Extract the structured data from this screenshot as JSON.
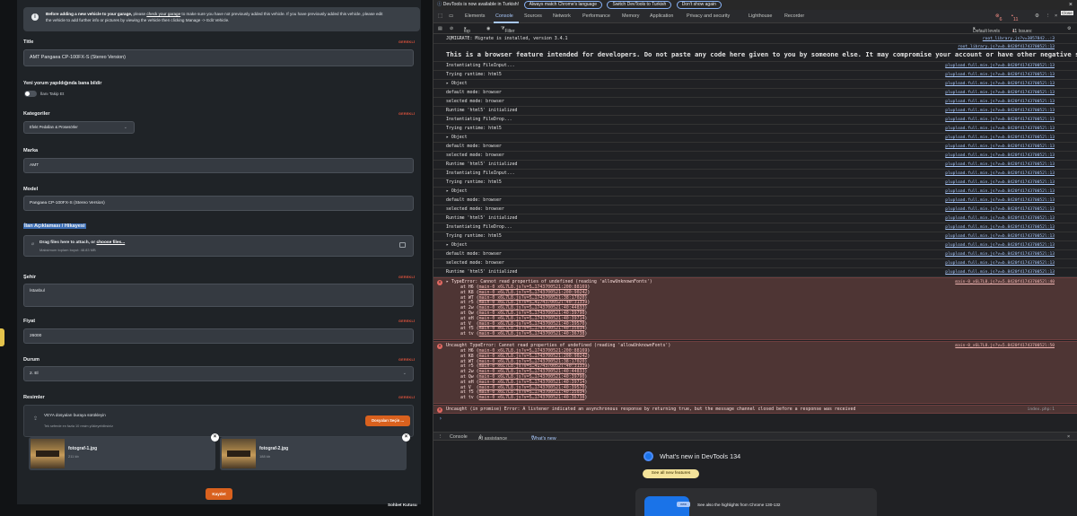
{
  "form": {
    "info_bold": "Before adding a new vehicle to your garage,",
    "info_mid": " please ",
    "info_link": "check your garage",
    "info_rest": " to make sure you have not previously added this vehicle. If you have previously added this vehicle, please edit",
    "info_line2": "the vehicle to add further info or pictures by viewing the vehicle then clicking Manage -> Edit Vehicle.",
    "required": "GEREKLİ",
    "title_label": "Title",
    "title_value": "AMT Pangaea CP-100FX-S (Stereo Version)",
    "notify_label": "Yeni yorum yapıldığında bana bildir",
    "toggle_label": "İlanı Takip Et",
    "category_label": "Kategoriler",
    "category_value": "Efekt Pedalları & Prosesörler",
    "brand_label": "Marka",
    "brand_value": "AMT",
    "model_label": "Model",
    "model_value": "Pangaea CP-100FX-S (Stereo Version)",
    "desc_label": "İlan Açıklaması / Hikayesi",
    "drop_text": "Drag files here to attach, or ",
    "drop_link": "choose files...",
    "drop_max": "Maksimum toplam boyut: 48.83 MB",
    "city_label": "Şehir",
    "city_value": "İstanbul",
    "price_label": "Fiyat",
    "price_value": "26000",
    "state_label": "Durum",
    "state_value": "2. El",
    "photos_label": "Resimler",
    "photos_drop": "VEYA dosyaları buraya sürükleyin",
    "photos_max": "Tek seferde en fazla 10 resim yükleyebilirsiniz",
    "photos_btn": "Dosyaları Seçin ...",
    "photo1_name": "fotograf-1.jpg",
    "photo1_size": "211 kb",
    "photo2_name": "fotograf-2.jpg",
    "photo2_size": "188 kb",
    "save_label": "Kaydet",
    "chat_label": "Sohbet Kutusu"
  },
  "devtools": {
    "notice": "DevTools is now available in Turkish!",
    "notice_b1": "Always match Chrome's language",
    "notice_b2": "Switch DevTools to Turkish",
    "notice_b3": "Don't show again",
    "tabs": [
      "Elements",
      "Console",
      "Sources",
      "Network",
      "Performance",
      "Memory",
      "Application",
      "Privacy and security",
      "Lighthouse",
      "Recorder"
    ],
    "errors_count": "6",
    "warn_count": "11",
    "close_tip": "Close",
    "context": "top",
    "filter": "Filter",
    "levels": "Default levels",
    "issues": "11 Issues:",
    "issues_count": "11",
    "log_first": "JQMIGRATE: Migrate is installed, version 3.4.1",
    "log_first_src": "root_library.js?v=3857842..:3",
    "big_src": "root_library.js?v=b.8420f4174370052l:13",
    "big_msg": "This is a browser feature intended for developers. Do not paste any code here given to you by someone else. It may compromise your account or have other negative side effects.",
    "plup_src": "plupload.full.min.js?v=b.8420f4174370052l:13",
    "logs": [
      "Instantiating FileInput...",
      "Trying runtime: html5",
      "▸ Object",
      "    default mode: browser",
      "    selected mode: browser",
      "Runtime 'html5' initialized",
      "Instantiating FileDrop...",
      "Trying runtime: html5",
      "▸ Object",
      "    default mode: browser",
      "    selected mode: browser",
      "Runtime 'html5' initialized",
      "Instantiating FileInput...",
      "Trying runtime: html5",
      "▸ Object",
      "    default mode: browser",
      "    selected mode: browser",
      "Runtime 'html5' initialized",
      "Instantiating FileDrop...",
      "Trying runtime: html5",
      "▸ Object",
      "    default mode: browser",
      "    selected mode: browser",
      "Runtime 'html5' initialized"
    ],
    "err1_msg": "▸ TypeError: Cannot read properties of undefined (reading 'allowUnknownFonts')",
    "err1_src": "main-0_x6L7L8.js?v=5.8420f4174370052l:40",
    "err2_msg": "Uncaught TypeError: Cannot read properties of undefined (reading 'allowUnknownFonts')",
    "err2_src": "main-0_x6L7L8.js?v=5.8420f4174370052l:50",
    "stack_fns": [
      "at H6",
      "at K8",
      "at WT",
      "at r5",
      "at 2w",
      "at Qw",
      "at eH",
      "at V_",
      "at f5",
      "at tv"
    ],
    "stack_srcs": [
      "main-0_x6L7L8.js?v=5…1743700521:200:88169",
      "main-0_x6L7L8.js?v=5…1743700521:200:90242",
      "main-0_x6L7L8.js?v=5…1743700521:38:17020",
      "main-0_x6L7L8.js?v=5…4174370052l:40:31339",
      "main-0_x6L7L8.js?v=5…1743700521:40:44833",
      "main-0_x6L7L8.js?v=5…1743700521:40:39790",
      "main-0_x6L7L8.js?v=5…1743700521:40:39714",
      "main-0_x6L7L8.js?v=5…1743700521:40:39570",
      "main-0_x6L7L8.js?v=5…1743700521:40:35034",
      "main-0_x6L7L8.js?v=5…1743700521:40:36738"
    ],
    "err3_msg": "Uncaught (in promise) Error: A listener indicated an asynchronous response by returning true, but the message channel closed before a response was received",
    "err3_src": "index.php:1",
    "drawer_tabs": [
      "Console",
      "AI assistance",
      "What's new"
    ],
    "wn_title": "What's new in DevTools 134",
    "wn_btn": "See all new features",
    "wn_new": "new",
    "wn_card": "See also the highlights from Chrome 130-132"
  }
}
